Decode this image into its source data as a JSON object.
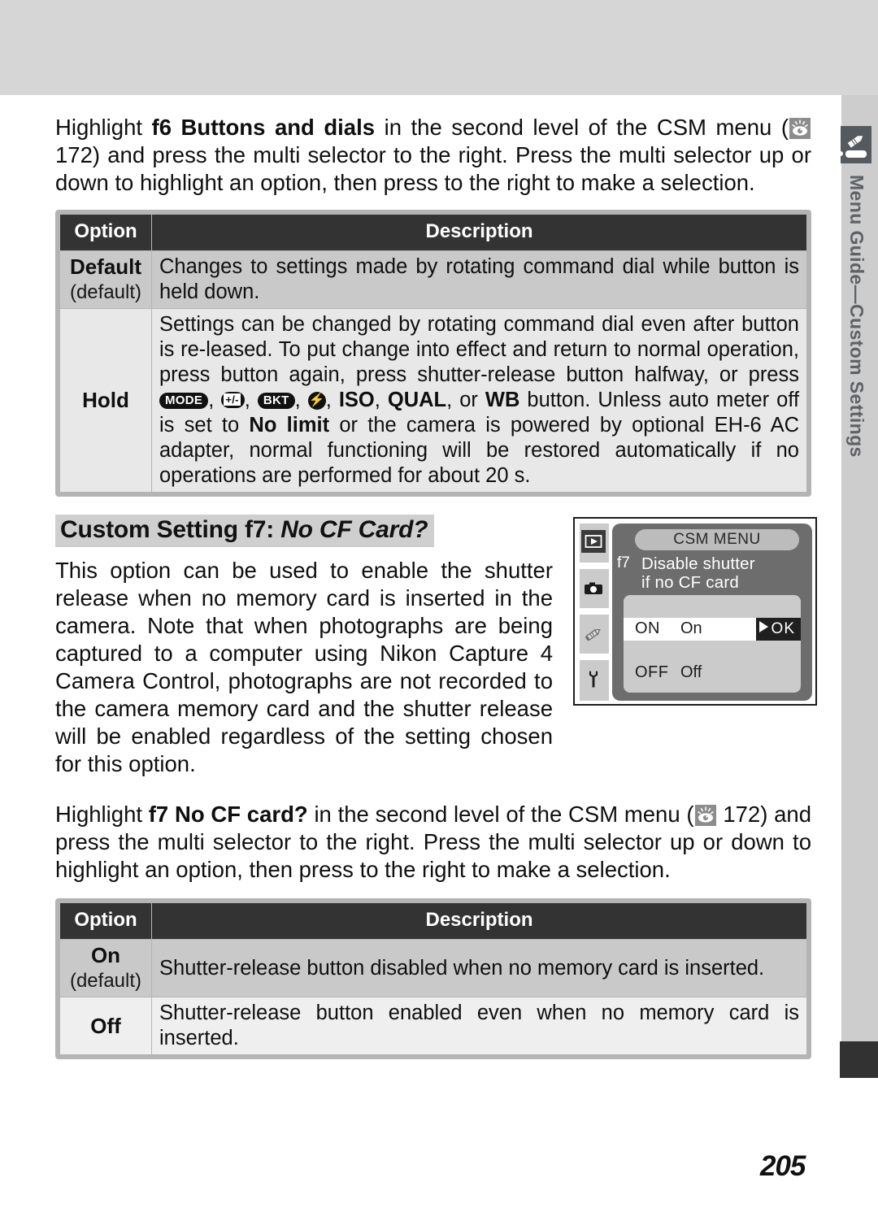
{
  "page": {
    "number": "205",
    "rail_label": "Menu Guide—Custom Settings",
    "rail_icon": "pencil-tab-icon"
  },
  "intro_f6": {
    "part1": "Highlight ",
    "bold1": "f6 Buttons and dials",
    "part2": " in the second level of the CSM menu (",
    "icon": "eye-reference-icon",
    "part3": " 172) and press the multi selector to the right.  Press the multi selector up or down to highlight an option, then press to the right to make a selection."
  },
  "table_f6": {
    "headers": {
      "option": "Option",
      "description": "Description"
    },
    "rows": [
      {
        "option_strong": "Default",
        "option_sub": "(default)",
        "description": "Changes to settings made by rotating command dial while button is held down."
      },
      {
        "option_strong": "Hold",
        "option_sub": "",
        "desc_seg1": "Settings can be changed by rotating command dial even after button is re-leased.  To put change into effect and return to normal operation, press button again, press shutter-release button halfway, or press ",
        "badge_mode": "MODE",
        "badge_ec": "+/-",
        "badge_bkt": "BKT",
        "badge_flash": "⚡",
        "desc_seg2": ", ",
        "desc_seg3": "ISO",
        "desc_seg4": ", ",
        "desc_seg5": "QUAL",
        "desc_seg6": ", or ",
        "desc_seg7": "WB",
        "desc_seg8": " button.  Unless auto meter off is set to ",
        "desc_bold_nolimit": "No limit",
        "desc_seg9": " or the camera is powered by optional EH-6 AC adapter, normal functioning will be restored automatically if no operations are performed for about 20 s."
      }
    ]
  },
  "section_f7": {
    "title_plain": "Custom Setting f7: ",
    "title_italic": "No CF Card?",
    "paragraph": "This option can be used to enable the shutter release when no memory card is inserted in the camera.  Note that when photographs are being captured to a computer using Nikon Capture 4 Camera Control, photographs are not recorded to the camera memory card and the shutter release will be enabled regardless of the setting chosen for this option."
  },
  "lcd": {
    "menu_title": "CSM MENU",
    "item_number": "f7",
    "item_title_line1": "Disable shutter",
    "item_title_line2": "if no CF card",
    "options": [
      {
        "code": "ON",
        "label": "On",
        "selected": true,
        "ok_label": "OK"
      },
      {
        "code": "OFF",
        "label": "Off",
        "selected": false
      }
    ],
    "side_icons": [
      "playback-icon",
      "camera-icon",
      "pencil-icon",
      "wrench-icon"
    ]
  },
  "intro_f7": {
    "part1": "Highlight ",
    "bold1": "f7 No CF card?",
    "part2": " in the second level of the CSM menu (",
    "icon": "eye-reference-icon",
    "part3": " 172) and press the multi selector to the right.  Press the multi selector up or down to highlight an option, then press to the right to make a selection."
  },
  "table_f7": {
    "headers": {
      "option": "Option",
      "description": "Description"
    },
    "rows": [
      {
        "option_strong": "On",
        "option_sub": "(default)",
        "description": "Shutter-release button disabled when no memory card is inserted."
      },
      {
        "option_strong": "Off",
        "option_sub": "",
        "description": "Shutter-release button enabled even when no memory card is inserted."
      }
    ]
  },
  "colors": {
    "band": "#d6d6d6",
    "rail": "#cdcdcd",
    "header_row": "#333333",
    "row_dark": "#c9c9c9",
    "row_light": "#e8e8e8",
    "lcd_screen": "#6d6d6d",
    "lcd_panel": "#cbcbcb"
  }
}
